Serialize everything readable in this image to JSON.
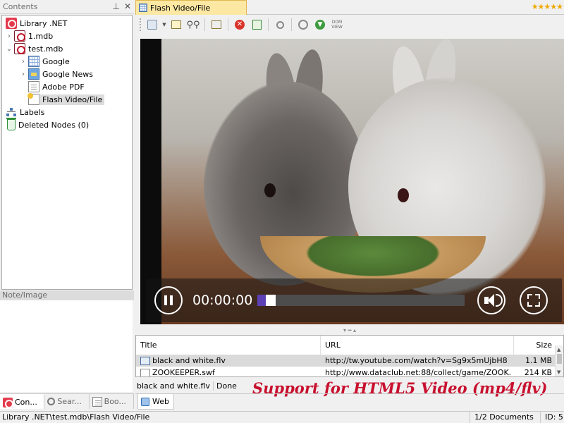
{
  "left_pane": {
    "header": "Contents",
    "header_icons": [
      "pin-icon",
      "close-icon"
    ],
    "tree": [
      {
        "label": "Library .NET",
        "icon": "library-icon",
        "expander": ""
      },
      {
        "label": "1.mdb",
        "icon": "database-icon",
        "expander": "›"
      },
      {
        "label": "test.mdb",
        "icon": "database-icon",
        "expander": "⌄"
      },
      {
        "label": "Google",
        "icon": "grid-page-icon",
        "expander": "›"
      },
      {
        "label": "Google News",
        "icon": "news-icon",
        "expander": "›"
      },
      {
        "label": "Adobe PDF",
        "icon": "page-icon",
        "expander": ""
      },
      {
        "label": "Flash Video/File",
        "icon": "flash-page-icon",
        "expander": "",
        "selected": true
      },
      {
        "label": "Labels",
        "icon": "labels-icon",
        "expander": ""
      },
      {
        "label": "Deleted Nodes (0)",
        "icon": "recycle-bin-icon",
        "expander": ""
      }
    ],
    "note_header": "Note/Image",
    "tabs": [
      {
        "label": "Con...",
        "active": true
      },
      {
        "label": "Sear..."
      },
      {
        "label": "Boo..."
      }
    ]
  },
  "document": {
    "tab_title": "Flash Video/File",
    "rating_stars": "★★★★★",
    "toolbar_icons": [
      "add-page-icon",
      "dropdown-arrow-icon",
      "properties-icon",
      "find-icon",
      "edit-icon",
      "stop-icon",
      "refresh-icon",
      "search-icon",
      "back-icon",
      "forward-icon",
      "dom-icon"
    ],
    "dom_label": "DOM\nVIEW"
  },
  "video": {
    "time": "00:00:00",
    "progress_fraction": 0.04,
    "play_state": "pause-icon",
    "volume_icon": "volume-icon",
    "fullscreen_icon": "fullscreen-icon"
  },
  "file_table": {
    "columns": [
      "Title",
      "URL",
      "Size"
    ],
    "rows": [
      {
        "title": "black and white.flv",
        "url": "http://tw.youtube.com/watch?v=Sg9x5mUjbH8",
        "size": "1.1 MB",
        "selected": true
      },
      {
        "title": "ZOOKEEPER.swf",
        "url": "http://www.dataclub.net:88/collect/game/ZOOK...",
        "size": "214 KB"
      }
    ]
  },
  "status_inner": {
    "file": "black and white.flv",
    "state": "Done"
  },
  "promo": "Support for HTML5 Video (mp4/flv)",
  "web_tab": "Web",
  "statusbar": {
    "path": "Library .NET\\test.mdb\\Flash Video/File",
    "documents": "1/2 Documents",
    "id": "ID: 5"
  },
  "colors": {
    "accent_tab": "#fde8a3",
    "promo_text": "#c8102e",
    "progress_fill": "#5b3fb3",
    "stars": "#f0a800"
  }
}
